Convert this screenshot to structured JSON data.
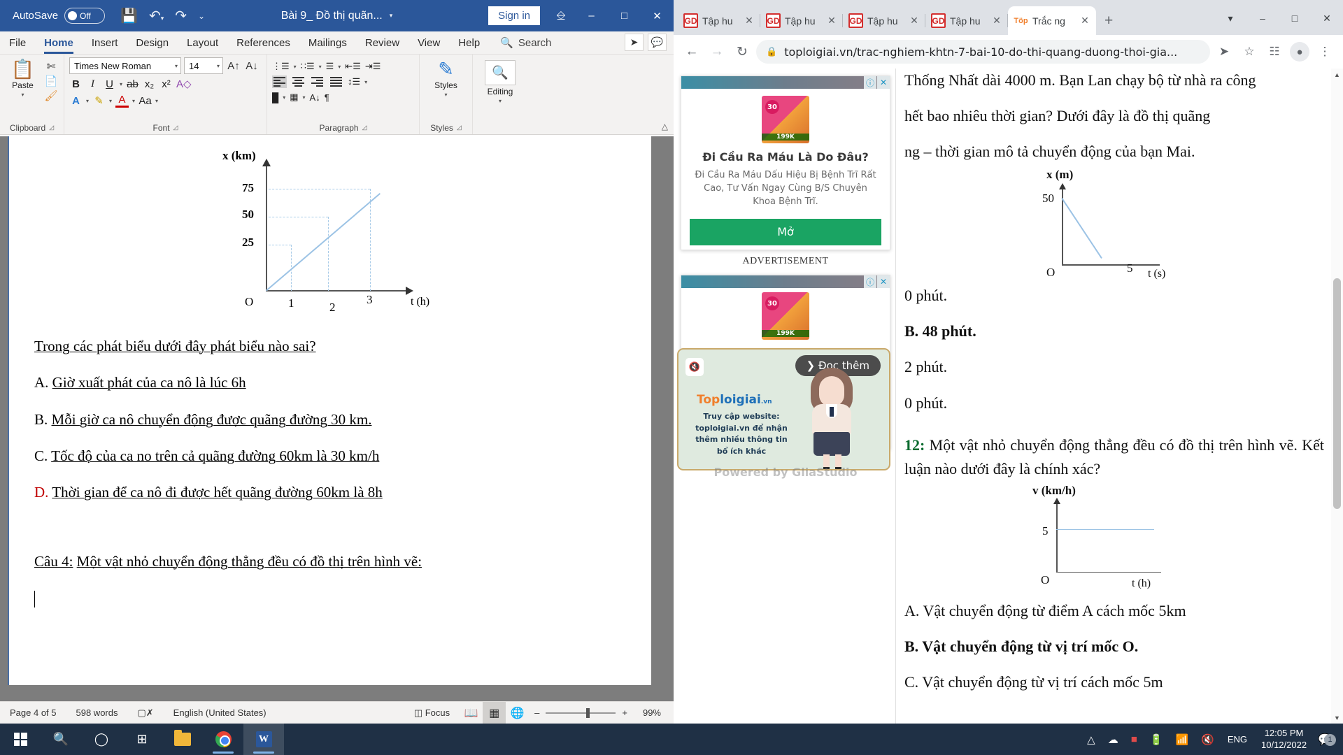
{
  "word": {
    "titlebar": {
      "autosave_label": "AutoSave",
      "autosave_state": "Off",
      "save_icon": "save-icon",
      "undo_icon": "undo-icon",
      "redo_icon": "redo-icon",
      "more_icon": "customize-quick-access-icon",
      "document_title": "Bài 9_ Đồ thị quãn...",
      "signin_label": "Sign in",
      "ribbon_display_icon": "ribbon-display-options-icon",
      "minimize": "–",
      "maximize": "□",
      "close": "✕"
    },
    "tabs": [
      "File",
      "Home",
      "Insert",
      "Design",
      "Layout",
      "References",
      "Mailings",
      "Review",
      "View",
      "Help"
    ],
    "active_tab": "Home",
    "search_placeholder": "Search",
    "share_icon": "share-icon",
    "comments_icon": "comments-icon",
    "ribbon": {
      "clipboard": {
        "label": "Clipboard",
        "paste": "Paste",
        "cut_icon": "scissors-icon",
        "copy_icon": "copy-icon",
        "format_painter_icon": "format-painter-icon"
      },
      "font": {
        "label": "Font",
        "font_name": "Times New Roman",
        "font_size": "14",
        "bold": "B",
        "italic": "I",
        "underline": "U",
        "strikethrough": "ab",
        "subscript": "x₂",
        "superscript": "x²",
        "clear_formatting_icon": "clear-formatting-icon",
        "text_highlight_icon": "text-highlight-icon",
        "font_color_icon": "font-color-icon",
        "change_case": "Aa",
        "grow_font": "A",
        "shrink_font": "A",
        "text_effects_icon": "text-effects-icon"
      },
      "paragraph": {
        "label": "Paragraph",
        "bullets_icon": "bullet-list-icon",
        "numbering_icon": "numbered-list-icon",
        "multilevel_icon": "multilevel-list-icon",
        "decrease_indent_icon": "decrease-indent-icon",
        "increase_indent_icon": "increase-indent-icon",
        "align_left_icon": "align-left-icon",
        "align_center_icon": "align-center-icon",
        "align_right_icon": "align-right-icon",
        "justify_icon": "justify-icon",
        "line_spacing_icon": "line-spacing-icon",
        "shading_icon": "shading-icon",
        "borders_icon": "borders-icon",
        "sort_icon": "sort-icon",
        "marks_icon": "formatting-marks-icon"
      },
      "styles": {
        "label": "Styles",
        "button": "Styles",
        "icon": "styles-icon"
      },
      "editing": {
        "label": "Editing",
        "button": "Editing",
        "icon": "find-icon"
      },
      "collapse_icon": "collapse-ribbon-icon"
    },
    "document": {
      "chart": {
        "y_axis_label": "x (km)",
        "x_axis_label": "t (h)",
        "origin_label": "O",
        "y_ticks": [
          "75",
          "50",
          "25"
        ],
        "x_ticks": [
          "1",
          "2",
          "3"
        ]
      },
      "paragraphs": [
        {
          "prefix": "",
          "text": "Trong các phát biểu dưới đây phát biểu nào sai?",
          "color": "black"
        },
        {
          "prefix": "A.",
          "text": "Giờ xuất phát của ca nô là lúc 6h",
          "color": "black"
        },
        {
          "prefix": "B.",
          "text": "Mỗi giờ ca nô chuyển động được quãng đường 30 km.",
          "color": "black"
        },
        {
          "prefix": "C.",
          "text": "Tốc độ của ca no trên cả quãng đường 60km là 30 km/h",
          "color": "black"
        },
        {
          "prefix": "D.",
          "text": "Thời gian để ca nô đi được hết quãng đường 60km là 8h",
          "color": "red"
        },
        {
          "prefix": "Câu 4:",
          "text": "Một vật nhỏ chuyển động thẳng đều có đồ thị trên hình vẽ:",
          "color": "black"
        }
      ]
    },
    "status": {
      "page": "Page 4 of 5",
      "words": "598 words",
      "proofing_icon": "proofing-errors-icon",
      "language": "English (United States)",
      "focus": "Focus",
      "focus_icon": "focus-icon",
      "read_mode_icon": "read-mode-icon",
      "print_layout_icon": "print-layout-icon",
      "web_layout_icon": "web-layout-icon",
      "zoom_out": "–",
      "zoom_in": "+",
      "zoom_level": "99%"
    }
  },
  "browser": {
    "tabs": [
      {
        "label": "Tập hu",
        "favicon": "gd-icon",
        "active": false
      },
      {
        "label": "Tập hu",
        "favicon": "gd-icon",
        "active": false
      },
      {
        "label": "Tập hu",
        "favicon": "gd-icon",
        "active": false
      },
      {
        "label": "Tập hu",
        "favicon": "gd-icon",
        "active": false
      },
      {
        "label": "Trắc ng",
        "favicon": "toploigiai-icon",
        "active": true
      }
    ],
    "new_tab_icon": "new-tab-icon",
    "window_controls": {
      "minimize": "–",
      "maximize": "□",
      "close": "✕"
    },
    "toolbar": {
      "back_icon": "back-arrow-icon",
      "forward_icon": "forward-arrow-icon",
      "reload_icon": "reload-icon",
      "lock_icon": "lock-icon",
      "url": "toploigiai.vn/trac-nghiem-khtn-7-bai-10-do-thi-quang-duong-thoi-gia...",
      "share_icon": "share-icon",
      "bookmark_icon": "star-icon",
      "extensions_icon": "extensions-icon",
      "profile_icon": "profile-avatar-icon",
      "menu_icon": "three-dot-menu-icon"
    },
    "page": {
      "article_text_1": "Thống Nhất dài 4000 m. Bạn Lan chạy bộ từ nhà ra công",
      "article_text_2": "hết bao nhiêu thời gian? Dưới đây là đồ thị quãng",
      "article_text_3": "ng – thời gian mô tả chuyển động của bạn Mai.",
      "chart1": {
        "y_axis_label": "x (m)",
        "x_axis_label": "t (s)",
        "origin_label": "O",
        "y_tick": "50",
        "x_tick": "5"
      },
      "answers_q11": [
        {
          "text": "0 phút.",
          "bold": false
        },
        {
          "text": "B. 48 phút.",
          "bold": true
        },
        {
          "text": "2 phút.",
          "bold": false
        },
        {
          "text": "0 phút.",
          "bold": false
        }
      ],
      "question12_num": "12:",
      "question12_text_1": "Một vật nhỏ chuyển động thẳng đều có đồ thị",
      "question12_text_2": "trên hình vẽ. Kết luận nào dưới đây là chính xác?",
      "chart2": {
        "y_axis_label": "v (km/h)",
        "x_axis_label": "t (h)",
        "origin_label": "O",
        "y_tick": "5"
      },
      "answers_q12": [
        {
          "text": "A. Vật chuyển động từ điểm A cách mốc 5km",
          "bold": false
        },
        {
          "text": "B. Vật chuyển động từ vị trí mốc O.",
          "bold": true
        },
        {
          "text": "C. Vật chuyển động từ vị trí cách mốc 5m",
          "bold": false
        }
      ],
      "ad1": {
        "info_icon": "ad-info-icon",
        "close_icon": "ad-close-icon",
        "title": "Đi Cầu Ra Máu Là Do Đâu?",
        "body": "Đi Cầu Ra Máu Dấu Hiệu Bị Bệnh Trĩ Rất Cao, Tư Vấn Ngay Cùng B/S Chuyên Khoa Bệnh Trĩ.",
        "cta": "Mở"
      },
      "ad_label": "ADVERTISEMENT",
      "ad2": {
        "info_icon": "ad-info-icon",
        "close_icon": "ad-close-icon"
      },
      "video_ad": {
        "mute_icon": "mute-icon",
        "read_more": "❯ Đọc thêm",
        "brand_top": "Top",
        "brand_loigiai": "loigiai",
        "brand_vn": ".vn",
        "text": "Truy cập website: toploigiai.vn để nhận thêm nhiều thông tin bổ ích khác"
      },
      "powered_by": "Powered by GliaStudio"
    }
  },
  "taskbar": {
    "start_icon": "windows-start-icon",
    "search_icon": "search-icon",
    "cortana_icon": "cortana-circle-icon",
    "taskview_icon": "task-view-icon",
    "explorer_icon": "file-explorer-icon",
    "chrome_icon": "chrome-icon",
    "word_icon": "word-icon",
    "tray": {
      "chevron_icon": "show-hidden-icons-icon",
      "onedrive_icon": "onedrive-icon",
      "v_icon": "v-app-icon",
      "battery_icon": "battery-icon",
      "wifi_icon": "wifi-icon",
      "volume_icon": "volume-muted-icon",
      "language": "ENG",
      "time": "12:05 PM",
      "date": "10/12/2022",
      "notification_icon": "notifications-icon",
      "notification_count": "1"
    }
  }
}
